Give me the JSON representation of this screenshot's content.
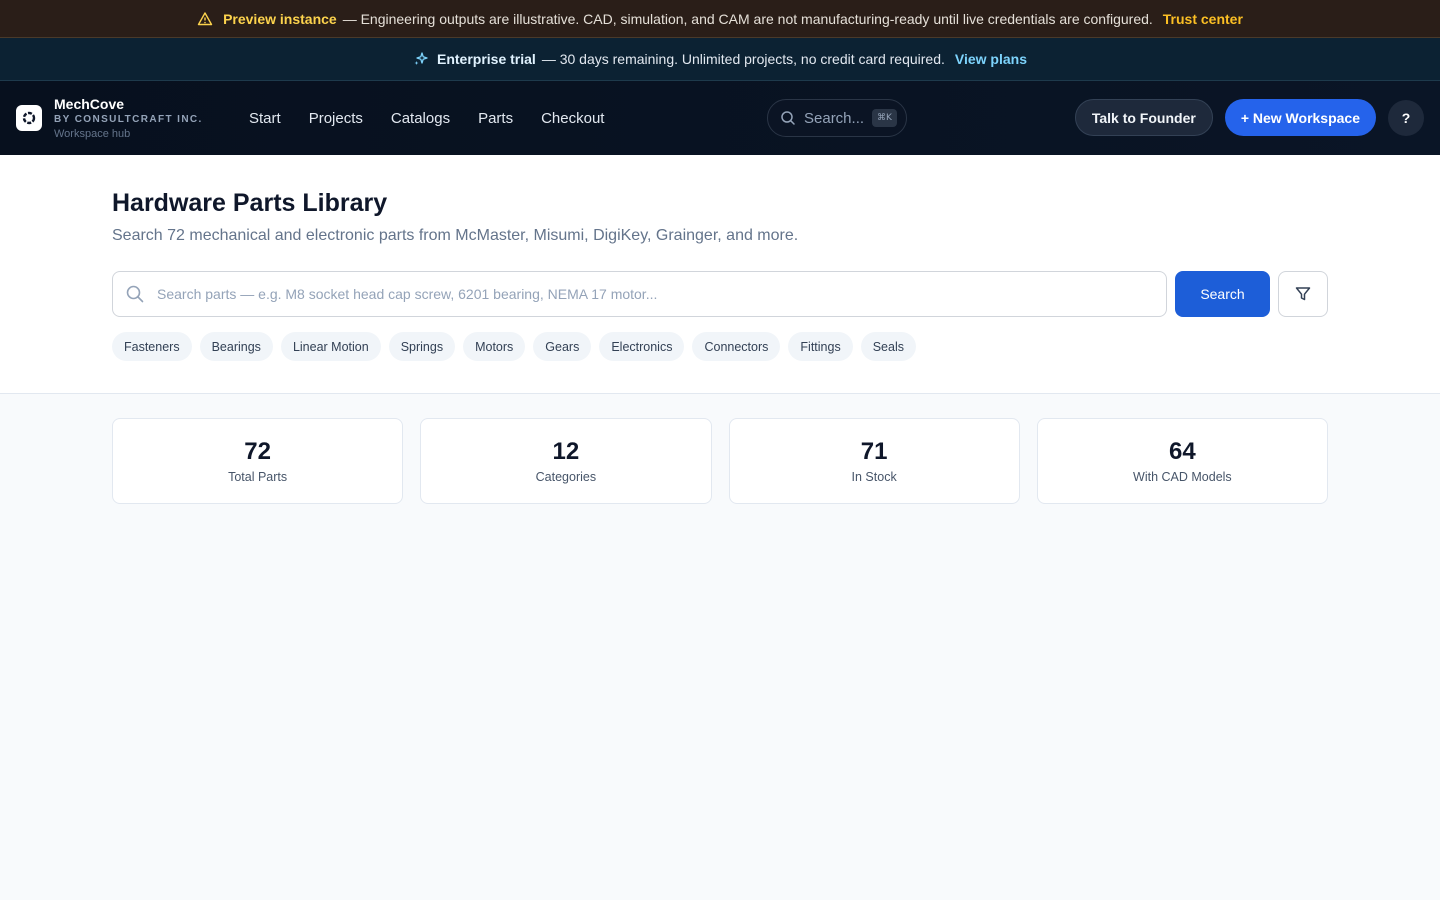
{
  "preview_banner": {
    "icon": "warning-icon",
    "bold": "Preview instance",
    "text": "— Engineering outputs are illustrative. CAD, simulation, and CAM are not manufacturing-ready until live credentials are configured.",
    "link": "Trust center"
  },
  "trial_banner": {
    "icon": "sparkles-icon",
    "bold": "Enterprise trial",
    "text": "— 30 days remaining. Unlimited projects, no credit card required.",
    "link": "View plans"
  },
  "nav": {
    "brand_name": "MechCove",
    "brand_by": "BY CONSULTCRAFT INC.",
    "brand_hub": "Workspace hub",
    "links": [
      "Start",
      "Projects",
      "Catalogs",
      "Parts",
      "Checkout"
    ],
    "search_placeholder": "Search...",
    "search_shortcut": "⌘K",
    "talk_button": "Talk to Founder",
    "new_button": "+ New Workspace",
    "help_button": "?"
  },
  "hero": {
    "title": "Hardware Parts Library",
    "subtitle": "Search 72 mechanical and electronic parts from McMaster, Misumi, DigiKey, Grainger, and more.",
    "search_placeholder": "Search parts — e.g. M8 socket head cap screw, 6201 bearing, NEMA 17 motor...",
    "search_button": "Search",
    "chips": [
      "Fasteners",
      "Bearings",
      "Linear Motion",
      "Springs",
      "Motors",
      "Gears",
      "Electronics",
      "Connectors",
      "Fittings",
      "Seals"
    ]
  },
  "stats": [
    {
      "value": "72",
      "label": "Total Parts"
    },
    {
      "value": "12",
      "label": "Categories"
    },
    {
      "value": "71",
      "label": "In Stock"
    },
    {
      "value": "64",
      "label": "With CAD Models"
    }
  ],
  "colors": {
    "accent": "#2563eb",
    "warning": "#fcd34d",
    "trial_link": "#7dd3fc"
  }
}
